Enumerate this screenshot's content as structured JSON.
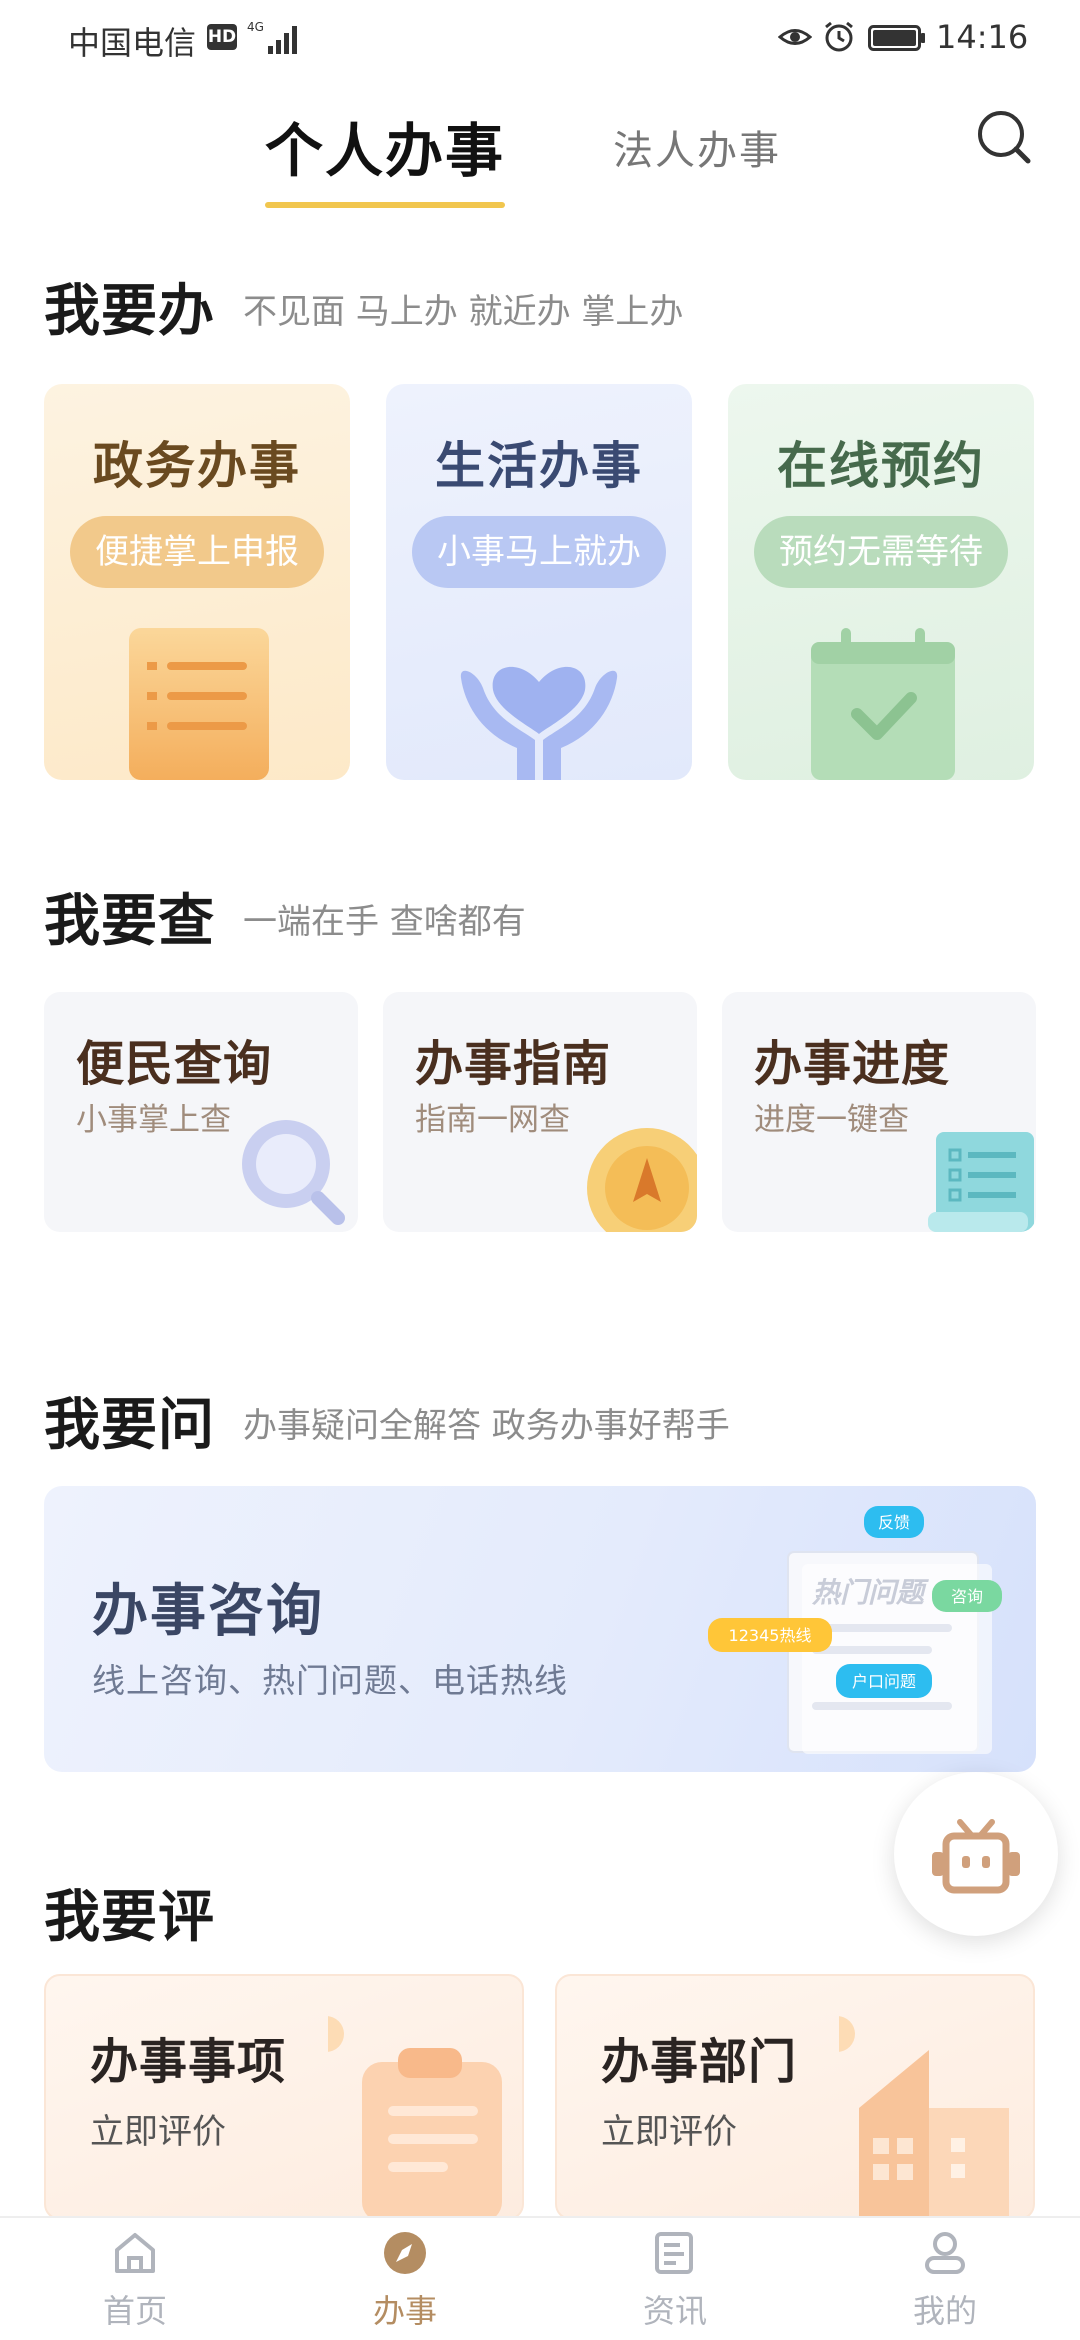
{
  "status_bar": {
    "carrier": "中国电信",
    "hd": "HD",
    "time": "14:16",
    "icons": [
      "signal-icon",
      "eye-icon",
      "alarm-icon",
      "battery-icon"
    ]
  },
  "tabs": [
    {
      "label": "个人办事",
      "active": true
    },
    {
      "label": "法人办事",
      "active": false
    }
  ],
  "sections": {
    "handle": {
      "title": "我要办",
      "subtitle": "不见面 马上办 就近办 掌上办",
      "cards": [
        {
          "title": "政务办事",
          "pill": "便捷掌上申报",
          "icon": "document-list-icon"
        },
        {
          "title": "生活办事",
          "pill": "小事马上就办",
          "icon": "heart-hands-icon"
        },
        {
          "title": "在线预约",
          "pill": "预约无需等待",
          "icon": "calendar-check-icon"
        }
      ]
    },
    "query": {
      "title": "我要查",
      "subtitle": "一端在手 查啥都有",
      "cards": [
        {
          "title": "便民查询",
          "subtitle": "小事掌上查",
          "icon": "magnifier-icon"
        },
        {
          "title": "办事指南",
          "subtitle": "指南一网查",
          "icon": "compass-icon"
        },
        {
          "title": "办事进度",
          "subtitle": "进度一键查",
          "icon": "checklist-scroll-icon"
        }
      ]
    },
    "ask": {
      "title": "我要问",
      "subtitle": "办事疑问全解答 政务办事好帮手",
      "banner": {
        "title": "办事咨询",
        "subtitle": "线上咨询、热门问题、电话热线",
        "art_heading": "热门问题",
        "bubbles": [
          "反馈",
          "咨询",
          "12345热线",
          "户口问题"
        ]
      }
    },
    "evaluate": {
      "title": "我要评",
      "cards": [
        {
          "title": "办事事项",
          "subtitle": "立即评价",
          "icon": "clipboard-icon"
        },
        {
          "title": "办事部门",
          "subtitle": "立即评价",
          "icon": "building-icon"
        }
      ]
    }
  },
  "bottom_nav": [
    {
      "label": "首页",
      "icon": "home-icon",
      "active": false
    },
    {
      "label": "办事",
      "icon": "compass-icon",
      "active": true
    },
    {
      "label": "资讯",
      "icon": "news-icon",
      "active": false
    },
    {
      "label": "我的",
      "icon": "user-icon",
      "active": false
    }
  ],
  "colors": {
    "tab_underline": "#f1c64e",
    "nav_active": "#b48d62",
    "nav_inactive": "#b0b4bc"
  }
}
